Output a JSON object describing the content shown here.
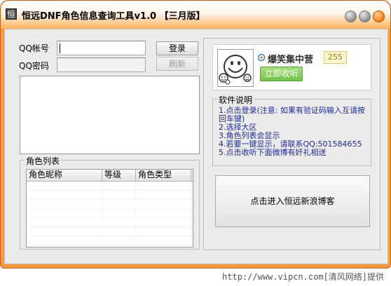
{
  "window": {
    "logo_char": "恒",
    "title": "恒远DNF角色信息查询工具v1.0   【三月版】"
  },
  "login": {
    "qq_label": "QQ帐号",
    "password_label": "QQ密码",
    "qq_value": "",
    "password_value": "",
    "login_button": "登录",
    "refresh_button": "刷新"
  },
  "roles": {
    "group_title": "角色列表",
    "columns": [
      "角色昵称",
      "等级",
      "角色类型"
    ]
  },
  "profile": {
    "name": "爆笑集中营",
    "fans_count": "255",
    "listen_button": "立即收听"
  },
  "description": {
    "title": "软件说明",
    "lines": [
      "1.点击登录(注意: 如果有验证码输入互请按回车键)",
      "2.选择大区",
      "3.角色列表会显示",
      "4.若要一键显示，请联系QQ:501584655",
      "5.点击收听下面微博有奸礼相送"
    ]
  },
  "actions": {
    "enter_weibo_button": "点击进入恒远新浪博客"
  },
  "footer": {
    "watermark": "http://www.vipcn.com[清风网络]提供"
  },
  "colors": {
    "frame_orange": "#ff9a3c",
    "desc_text_blue": "#1c2a9c",
    "listen_green": "#73c046"
  },
  "icons": {
    "avatar": "smiley-face-icon",
    "weibo": "weibo-icon",
    "minimize": "minimize-icon",
    "maximize": "maximize-icon",
    "close": "close-icon"
  }
}
